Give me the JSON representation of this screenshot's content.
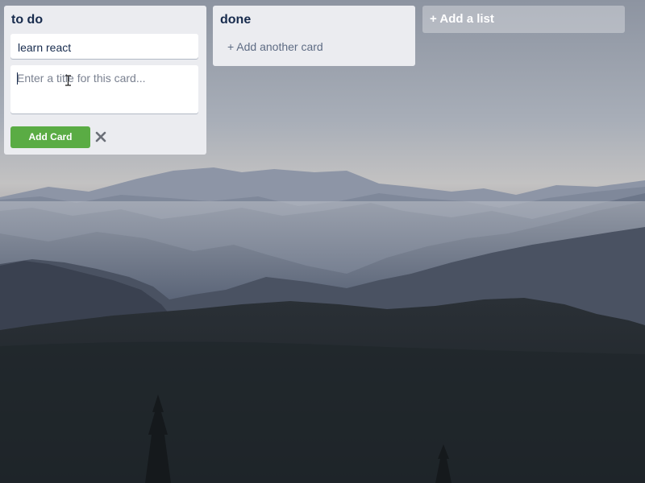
{
  "lists": [
    {
      "title": "to do",
      "cards": [
        "learn react"
      ],
      "composer": {
        "placeholder": "Enter a title for this card...",
        "add_button_label": "Add Card",
        "close_icon": "close-icon"
      }
    },
    {
      "title": "done",
      "cards": [],
      "add_card_label": "+ Add another card"
    }
  ],
  "add_list_label": "+ Add a list",
  "colors": {
    "list_background": "#ebecf0",
    "add_button": "#5aac44",
    "title_text": "#172b4d",
    "muted_text": "#5e6c84"
  }
}
